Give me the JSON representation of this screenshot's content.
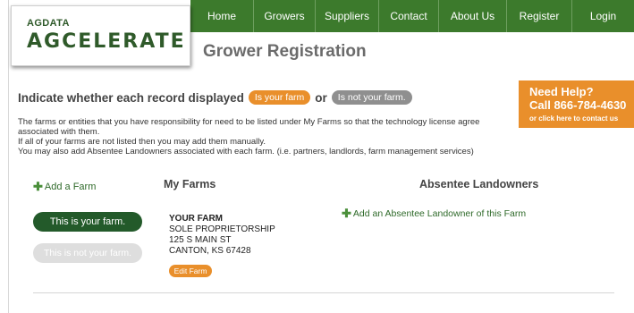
{
  "logo": {
    "small": "AGDATA",
    "big": "AGCELERATE"
  },
  "nav": [
    {
      "label": "Home"
    },
    {
      "label": "Growers"
    },
    {
      "label": "Suppliers"
    },
    {
      "label": "Contact"
    },
    {
      "label": "About Us"
    },
    {
      "label": "Register"
    },
    {
      "label": "Login"
    }
  ],
  "page_title": "Grower Registration",
  "indicate": {
    "prefix": "Indicate whether each record displayed",
    "is_your_farm": "Is your farm",
    "or": "or",
    "is_not_your_farm": "Is not your farm."
  },
  "help": {
    "line1": "Need Help?",
    "line2": "Call 866-784-4630",
    "line3": "or click here to contact us"
  },
  "instructions": {
    "line1": "The farms or entities that you have responsibility for need to be listed under My Farms so that the technology license agree",
    "line2": "associated with them.",
    "line3": "If all of your farms are not listed then you may add them manually.",
    "line4": "You may also add Absentee Landowners associated with each farm. (i.e. partners, landlords, farm management services)"
  },
  "add_farm": "Add a Farm",
  "my_farms_header": "My Farms",
  "absentee_header": "Absentee Landowners",
  "toggle": {
    "yes": "This is your farm.",
    "no": "This is not your farm."
  },
  "farm": {
    "name": "YOUR FARM",
    "type": "SOLE PROPRIETORSHIP",
    "address": "125 S MAIN ST",
    "city": "CANTON, KS 67428",
    "edit": "Edit Farm"
  },
  "add_absentee": "Add an Absentee Landowner of this Farm",
  "colors": {
    "nav": "#3c7a2c",
    "accent": "#e98f2b",
    "dark_green": "#235a2a"
  },
  "icons": {
    "plus": "plus-icon"
  }
}
